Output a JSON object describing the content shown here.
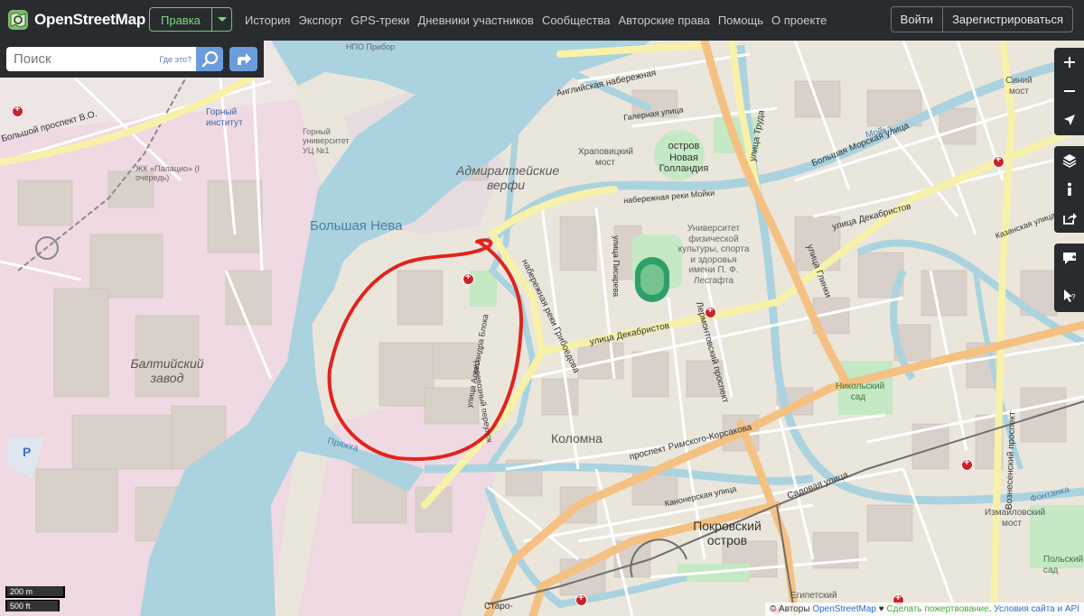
{
  "header": {
    "logo_text": "OpenStreetMap",
    "edit_label": "Правка",
    "nav": [
      "История",
      "Экспорт",
      "GPS-треки",
      "Дневники участников",
      "Сообщества",
      "Авторские права",
      "Помощь",
      "О проекте"
    ],
    "login_label": "Войти",
    "signup_label": "Зарегистрироваться"
  },
  "search": {
    "placeholder": "Поиск",
    "whereis_label": "Где это?"
  },
  "controls": [
    "zoom-in-icon",
    "zoom-out-icon",
    "geolocate-icon",
    "layers-icon",
    "info-icon",
    "share-icon",
    "note-icon",
    "query-icon"
  ],
  "scale": {
    "metric": "200 m",
    "imperial": "500 ft"
  },
  "attribution": {
    "copyright": "© Авторы",
    "osm_link": "OpenStreetMap",
    "heart": "♥",
    "donate_link": "Сделать пожертвование",
    "separator": ".",
    "terms_link": "Условия сайта и API"
  },
  "map_labels": {
    "admiralty": "Адмиралтейские верфи",
    "bolshaya_neva": "Большая Нева",
    "baltic": "Балтийский завод",
    "kolomna": "Коломна",
    "pokrovsky": "Покровский остров",
    "new_holland": "остров Новая Голландия",
    "mining_inst": "Горный институт",
    "mining_univ": "Горный университет УЦ №1",
    "palazzo": "ЖК «Палацио» (I очередь)",
    "nikolsky": "Никольский сад",
    "polsky": "Польский сад",
    "izmailovsky": "Измайловский мост",
    "sinii": "Синий мост",
    "egipetsky": "Египетский",
    "khrapovitsky": "Храповицкий мост",
    "university": "Университет физической культуры, спорта и здоровья имени П. Ф. Лесгафта",
    "npo": "НПО Прибор",
    "staro": "Старо-",
    "pryazhka": "Пряжка",
    "angl_nab": "Английская набережная",
    "blok": "улица Александра Блока",
    "dekabristov1": "улица Декабристов",
    "dekabristov2": "улица Декабристов",
    "rimsky": "проспект Римского-Корсакова",
    "nab_gribo": "набережная реки Грибоедова",
    "glinki": "улица Глинки",
    "truda": "улица Труда",
    "lermont": "Лермонтовский проспект",
    "sadovaya": "Садовая улица",
    "bmorskaya": "Большая Морская улица",
    "moika": "Мойка",
    "nab_moiki": "набережная реки Мойки",
    "voznes": "Вознесенский проспект",
    "bolshoy_vo": "Большой проспект В.О.",
    "fontanka": "Фонтанка",
    "pisareva": "улица Писарева",
    "perevoz": "Перевозный переулок",
    "kanonerskaya": "Канонерская улица",
    "galernaya": "Галерная улица",
    "kazanskaya": "Казанская улица"
  }
}
